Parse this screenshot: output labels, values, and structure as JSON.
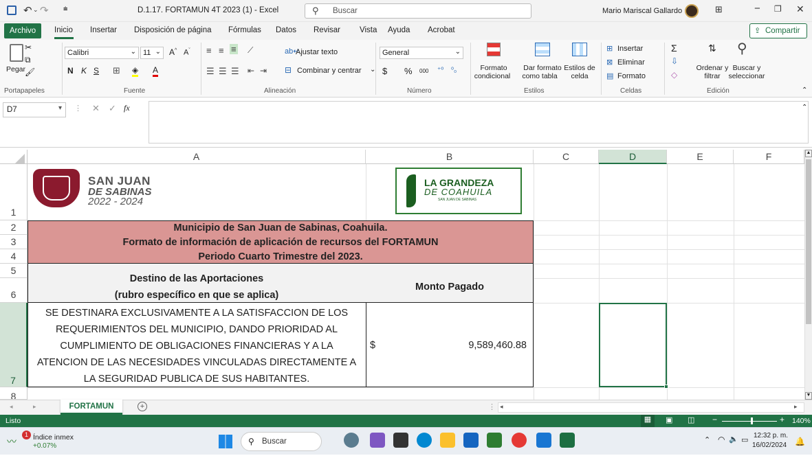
{
  "window": {
    "title": "D.1.17. FORTAMUN 4T 2023 (1)  -  Excel",
    "search_placeholder": "Buscar",
    "user": "Mario Mariscal Gallardo"
  },
  "ribbon_tabs": [
    "Archivo",
    "Inicio",
    "Insertar",
    "Disposición de página",
    "Fórmulas",
    "Datos",
    "Revisar",
    "Vista",
    "Ayuda",
    "Acrobat"
  ],
  "share_label": "Compartir",
  "ribbon": {
    "paste": "Pegar",
    "font_name": "Calibri",
    "font_size": "11",
    "bold": "N",
    "italic": "K",
    "underline": "S",
    "wrap_text": "Ajustar texto",
    "merge_center": "Combinar y centrar",
    "number_format": "General",
    "currency": "$",
    "percent": "%",
    "thousands": "000",
    "cond_format_1": "Formato",
    "cond_format_2": "condicional",
    "format_table_1": "Dar formato",
    "format_table_2": "como tabla",
    "cell_styles_1": "Estilos de",
    "cell_styles_2": "celda",
    "insert": "Insertar",
    "delete": "Eliminar",
    "format": "Formato",
    "sort_1": "Ordenar y",
    "sort_2": "filtrar",
    "find_1": "Buscar y",
    "find_2": "seleccionar",
    "groups": [
      "Portapapeles",
      "Fuente",
      "Alineación",
      "Número",
      "Estilos",
      "Celdas",
      "Edición"
    ]
  },
  "formula_bar": {
    "name_box": "D7",
    "fx": "fx",
    "content": ""
  },
  "columns": [
    "A",
    "B",
    "C",
    "D",
    "E",
    "F"
  ],
  "rows": [
    "1",
    "2",
    "3",
    "4",
    "5",
    "6",
    "7",
    "8"
  ],
  "logos": {
    "left_line1": "SAN JUAN",
    "left_line2": "DE SABINAS",
    "left_line3": "2022 - 2024",
    "right_line1": "LA GRANDEZA",
    "right_line2": "DE COAHUILA",
    "right_line3": "SAN JUAN DE SABINAS"
  },
  "sheet": {
    "header_line1": "Municipio de San Juan de Sabinas, Coahuila.",
    "header_line2": "Formato de información de aplicación de recursos del FORTAMUN",
    "header_line3": "Periodo Cuarto Trimestre del 2023.",
    "col_a_title1": "Destino de las Aportaciones",
    "col_a_title2": "(rubro específico en que se aplica)",
    "col_b_title": "Monto Pagado",
    "row7_lines": [
      "SE DESTINARA EXCLUSIVAMENTE A LA SATISFACCION DE LOS",
      "REQUERIMIENTOS DEL MUNICIPIO, DANDO PRIORIDAD AL",
      "CUMPLIMIENTO DE OBLIGACIONES FINANCIERAS Y A LA",
      "ATENCION DE LAS NECESIDADES VINCULADAS DIRECTAMENTE A",
      "LA SEGURIDAD PUBLICA DE SUS HABITANTES."
    ],
    "currency_symbol": "$",
    "amount": "9,589,460.88"
  },
  "sheet_tab": "FORTAMUN",
  "status": {
    "ready": "Listo",
    "zoom": "140%"
  },
  "taskbar": {
    "widget_title": "Índice inmex",
    "widget_value": "+0.07%",
    "search": "Buscar",
    "time": "12:32 p. m.",
    "date": "16/02/2024",
    "notif_count": "1"
  },
  "colors": {
    "excel_green": "#217346",
    "header_fill": "#da9694",
    "title_fill": "#f2f2f2"
  }
}
